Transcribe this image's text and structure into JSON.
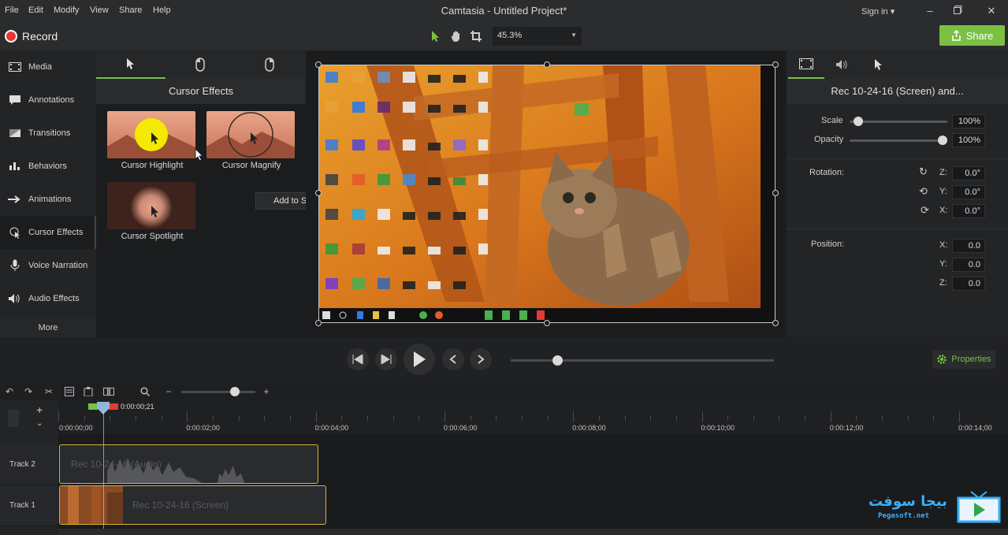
{
  "menu": {
    "items": [
      "File",
      "Edit",
      "Modify",
      "View",
      "Share",
      "Help"
    ],
    "title": "Camtasia - Untitled Project*",
    "sign_in": "Sign in ▾"
  },
  "toolbar": {
    "record_label": "Record",
    "zoom": "45.3%",
    "share_label": "Share"
  },
  "sidebar": {
    "items": [
      {
        "label": "Media",
        "icon": "media-icon"
      },
      {
        "label": "Annotations",
        "icon": "annotation-icon"
      },
      {
        "label": "Transitions",
        "icon": "transition-icon"
      },
      {
        "label": "Behaviors",
        "icon": "behaviors-icon"
      },
      {
        "label": "Animations",
        "icon": "animation-icon"
      },
      {
        "label": "Cursor Effects",
        "icon": "cursor-effects-icon"
      },
      {
        "label": "Voice Narration",
        "icon": "microphone-icon"
      },
      {
        "label": "Audio Effects",
        "icon": "speaker-icon"
      }
    ],
    "more_label": "More"
  },
  "effects_panel": {
    "title": "Cursor Effects",
    "cards": [
      {
        "label": "Cursor Highlight"
      },
      {
        "label": "Cursor Magnify"
      },
      {
        "label": "Cursor Spotlight"
      }
    ],
    "tooltip": "Add to Selected Media"
  },
  "properties": {
    "title": "Rec 10-24-16 (Screen) and...",
    "scale_label": "Scale",
    "scale_value": "100%",
    "opacity_label": "Opacity",
    "opacity_value": "100%",
    "scale_level": 0.09,
    "opacity_level": 1.0,
    "rotation_label": "Rotation:",
    "rotation": [
      {
        "axis": "Z:",
        "value": "0.0°"
      },
      {
        "axis": "Y:",
        "value": "0.0°"
      },
      {
        "axis": "X:",
        "value": "0.0°"
      }
    ],
    "position_label": "Position:",
    "position": [
      {
        "axis": "X:",
        "value": "0.0"
      },
      {
        "axis": "Y:",
        "value": "0.0"
      },
      {
        "axis": "Z:",
        "value": "0.0"
      }
    ],
    "properties_button": "Properties"
  },
  "timeline": {
    "playhead_time": "0:00:00;21",
    "ticks": [
      "0:00:00;00",
      "0:00:02;00",
      "0:00:04;00",
      "0:00:06;00",
      "0:00:08;00",
      "0:00:10;00",
      "0:00:12;00",
      "0:00:14;00"
    ],
    "tracks": [
      {
        "name": "Track 2",
        "clip": "Rec 10-24-16 (Audio)"
      },
      {
        "name": "Track 1",
        "clip": "Rec 10-24-16 (Screen)"
      }
    ]
  },
  "watermark": {
    "name_ar": "بيجا سوفت",
    "site": "Pegasoft.net"
  },
  "colors": {
    "accent_green": "#7ac143",
    "record_red": "#e53935",
    "clip_border": "#d6b13a"
  }
}
